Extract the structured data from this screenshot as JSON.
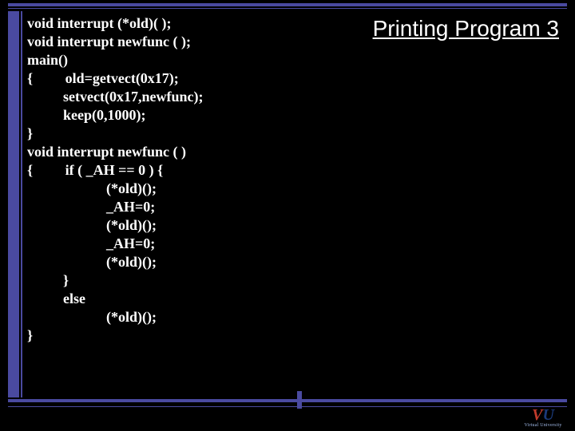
{
  "title": "Printing Program 3",
  "code": "void interrupt (*old)( );\nvoid interrupt newfunc ( );\nmain()\n{         old=getvect(0x17);\n          setvect(0x17,newfunc);\n          keep(0,1000);\n}\nvoid interrupt newfunc ( )\n{         if ( _AH == 0 ) {\n                      (*old)();\n                      _AH=0;\n                      (*old)();\n                      _AH=0;\n                      (*old)();\n          }\n          else\n                      (*old)();\n}",
  "logo": {
    "initials_v": "V",
    "initials_u": "U",
    "subtitle": "Virtual University"
  }
}
